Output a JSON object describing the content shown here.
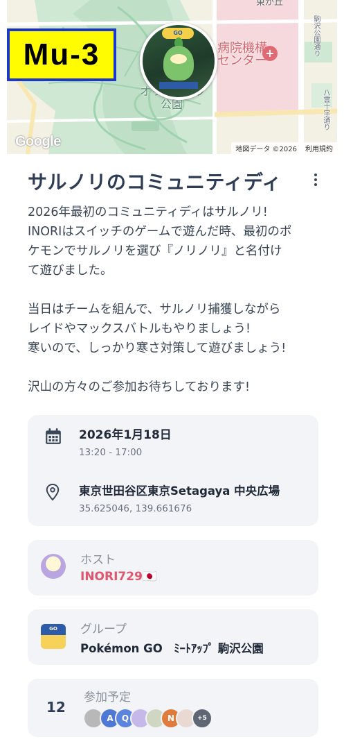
{
  "badge": {
    "label": "Mu-3"
  },
  "map": {
    "labels": {
      "top_right": "東が丘",
      "hospital_line1": "病院機構",
      "hospital_line2": "センター",
      "road_right": "駒沢公園通り",
      "road_right2": "八雲十字通り",
      "park_line1": "オリンピック",
      "park_line2": "公園"
    },
    "google_logo": "Google",
    "attribution": "地図データ ©2026",
    "terms": "利用規約"
  },
  "event": {
    "title": "サルノリのコミュニティディ",
    "description": [
      "2026年最初のコミュニティディはサルノリ!\nINORIはスイッチのゲームで遊んだ時、最初のポ\nケモンでサルノリを選び『ノリノリ』と名付け\nて遊びました。",
      "当日はチームを組んで、サルノリ捕獲しながら\nレイドやマックスバトルもやりましょう!\n寒いので、しっかり寒さ対策して遊びましょう!",
      "沢山の方々のご参加お待ちしております!"
    ]
  },
  "details": {
    "date": "2026年1月18日",
    "time": "13:20 - 17:00",
    "location": "東京世田谷区東京Setagaya 中央広場",
    "coords": "35.625046, 139.661676"
  },
  "host": {
    "label": "ホスト",
    "name": "INORI729🇯🇵",
    "name_color": "#e0566e"
  },
  "group": {
    "label": "グループ",
    "name": "Pokémon GO　ﾐｰﾄｱｯﾌﾟ 駒沢公園"
  },
  "attendees": {
    "label": "参加予定",
    "count": "12",
    "avatars": [
      "A",
      "Q",
      "N"
    ],
    "more": "+5"
  }
}
